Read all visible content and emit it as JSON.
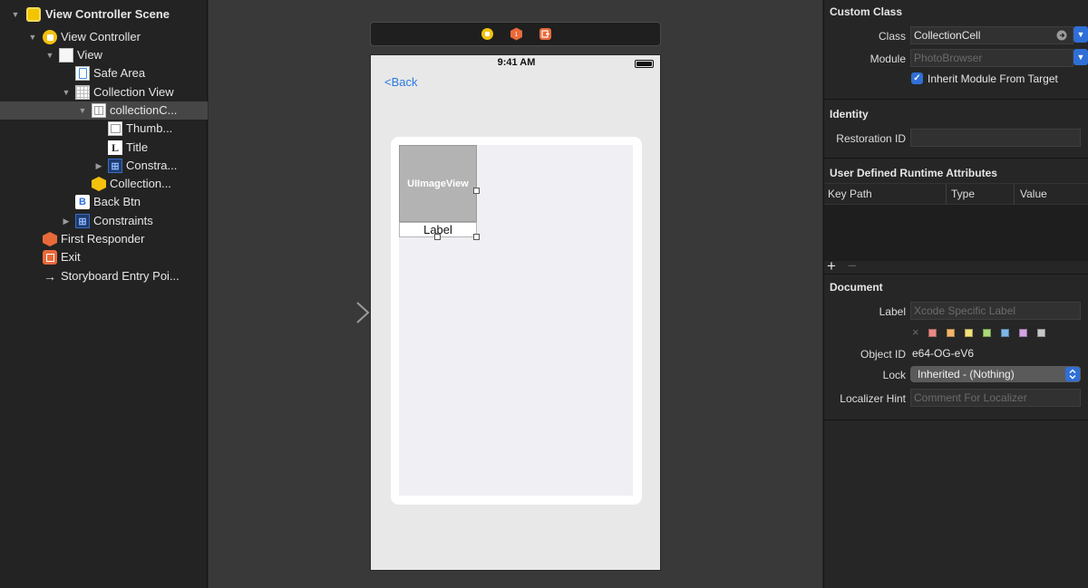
{
  "outline": {
    "items": [
      {
        "label": "View Controller Scene",
        "icon": "scene-icon",
        "disclosure": "▼",
        "bold": true,
        "selected": false
      },
      {
        "label": "View Controller",
        "icon": "view-controller-icon",
        "disclosure": "▼",
        "bold": false,
        "selected": false
      },
      {
        "label": "View",
        "icon": "view-icon",
        "disclosure": "▼",
        "bold": false,
        "selected": false
      },
      {
        "label": "Safe Area",
        "icon": "safe-area-icon",
        "disclosure": "",
        "bold": false,
        "selected": false
      },
      {
        "label": "Collection View",
        "icon": "collection-view-icon",
        "disclosure": "▼",
        "bold": false,
        "selected": false
      },
      {
        "label": "collectionC...",
        "icon": "collection-cell-icon",
        "disclosure": "▼",
        "bold": false,
        "selected": true
      },
      {
        "label": "Thumb...",
        "icon": "image-view-icon",
        "disclosure": "",
        "bold": false,
        "selected": false
      },
      {
        "label": "Title",
        "icon": "label-icon",
        "disclosure": "",
        "bold": false,
        "selected": false
      },
      {
        "label": "Constra...",
        "icon": "constraints-icon",
        "disclosure": "▶",
        "bold": false,
        "selected": false
      },
      {
        "label": "Collection...",
        "icon": "cube-icon",
        "disclosure": "",
        "bold": false,
        "selected": false
      },
      {
        "label": "Back Btn",
        "icon": "button-icon",
        "disclosure": "",
        "bold": false,
        "selected": false
      },
      {
        "label": "Constraints",
        "icon": "constraints-icon",
        "disclosure": "▶",
        "bold": false,
        "selected": false
      },
      {
        "label": "First Responder",
        "icon": "first-responder-icon",
        "disclosure": "",
        "bold": false,
        "selected": false
      },
      {
        "label": "Exit",
        "icon": "exit-icon",
        "disclosure": "",
        "bold": false,
        "selected": false
      },
      {
        "label": "Storyboard Entry Poi...",
        "icon": "arrow-right-icon",
        "disclosure": "",
        "bold": false,
        "selected": false
      }
    ]
  },
  "canvas": {
    "status_time": "9:41 AM",
    "back_label": "<Back",
    "image_view_label": "UIImageView",
    "cell_label": "Label"
  },
  "inspector": {
    "custom_class": {
      "title": "Custom Class",
      "class_label": "Class",
      "class_value": "CollectionCell",
      "module_label": "Module",
      "module_placeholder": "PhotoBrowser",
      "inherit_label": "Inherit Module From Target",
      "inherit_checked": true
    },
    "identity": {
      "title": "Identity",
      "restoration_label": "Restoration ID",
      "restoration_value": ""
    },
    "udra": {
      "title": "User Defined Runtime Attributes",
      "columns": [
        "Key Path",
        "Type",
        "Value"
      ],
      "add_symbol": "+",
      "remove_symbol": "−"
    },
    "document": {
      "title": "Document",
      "label_label": "Label",
      "label_placeholder": "Xcode Specific Label",
      "clear_symbol": "×",
      "swatches": [
        "#e98a86",
        "#f3b56b",
        "#f2e07a",
        "#a9d978",
        "#7fb6e8",
        "#d3a4e6",
        "#c7c7c7"
      ],
      "object_id_label": "Object ID",
      "object_id_value": "e64-OG-eV6",
      "lock_label": "Lock",
      "lock_value": "Inherited - (Nothing)",
      "localizer_label": "Localizer Hint",
      "localizer_placeholder": "Comment For Localizer"
    }
  }
}
